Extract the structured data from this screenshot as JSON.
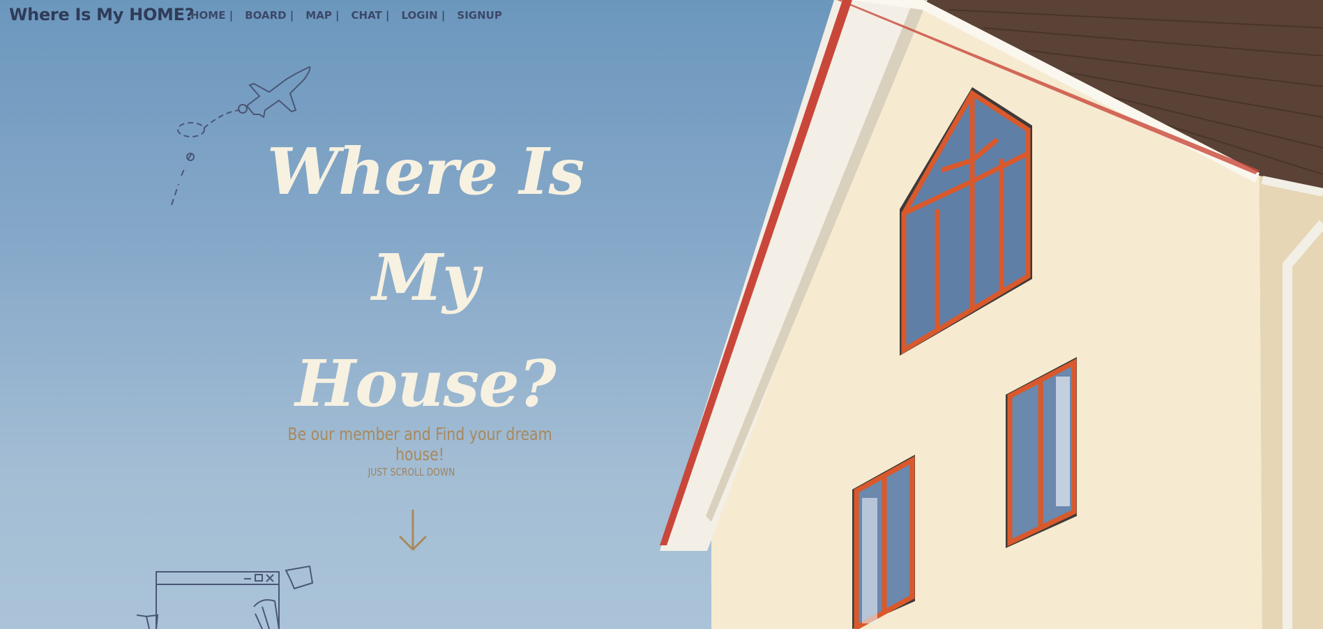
{
  "brand": {
    "title": "Where Is My HOME?"
  },
  "nav": {
    "items": [
      {
        "label": "HOME |"
      },
      {
        "label": "BOARD |"
      },
      {
        "label": "MAP |"
      },
      {
        "label": "CHAT |"
      },
      {
        "label": "LOGIN |"
      },
      {
        "label": "SIGNUP"
      }
    ]
  },
  "hero": {
    "title_line1": "Where Is My",
    "title_line2": "House?",
    "tagline": "Be our member and Find your dream house!",
    "scroll_label": "JUST SCROLL DOWN"
  },
  "icons": {
    "plane": "paper-plane-doodle-icon",
    "arrow": "arrow-down-icon",
    "sketch": "browser-window-doodle-icon"
  },
  "colors": {
    "sky": "#7ea2c4",
    "title_cream": "#f7f1e1",
    "accent_tan": "#a8895c",
    "nav_text": "#3c4868",
    "house_wall": "#f6ead0",
    "window_frame": "#d4512a",
    "roof": "#5a4034"
  }
}
